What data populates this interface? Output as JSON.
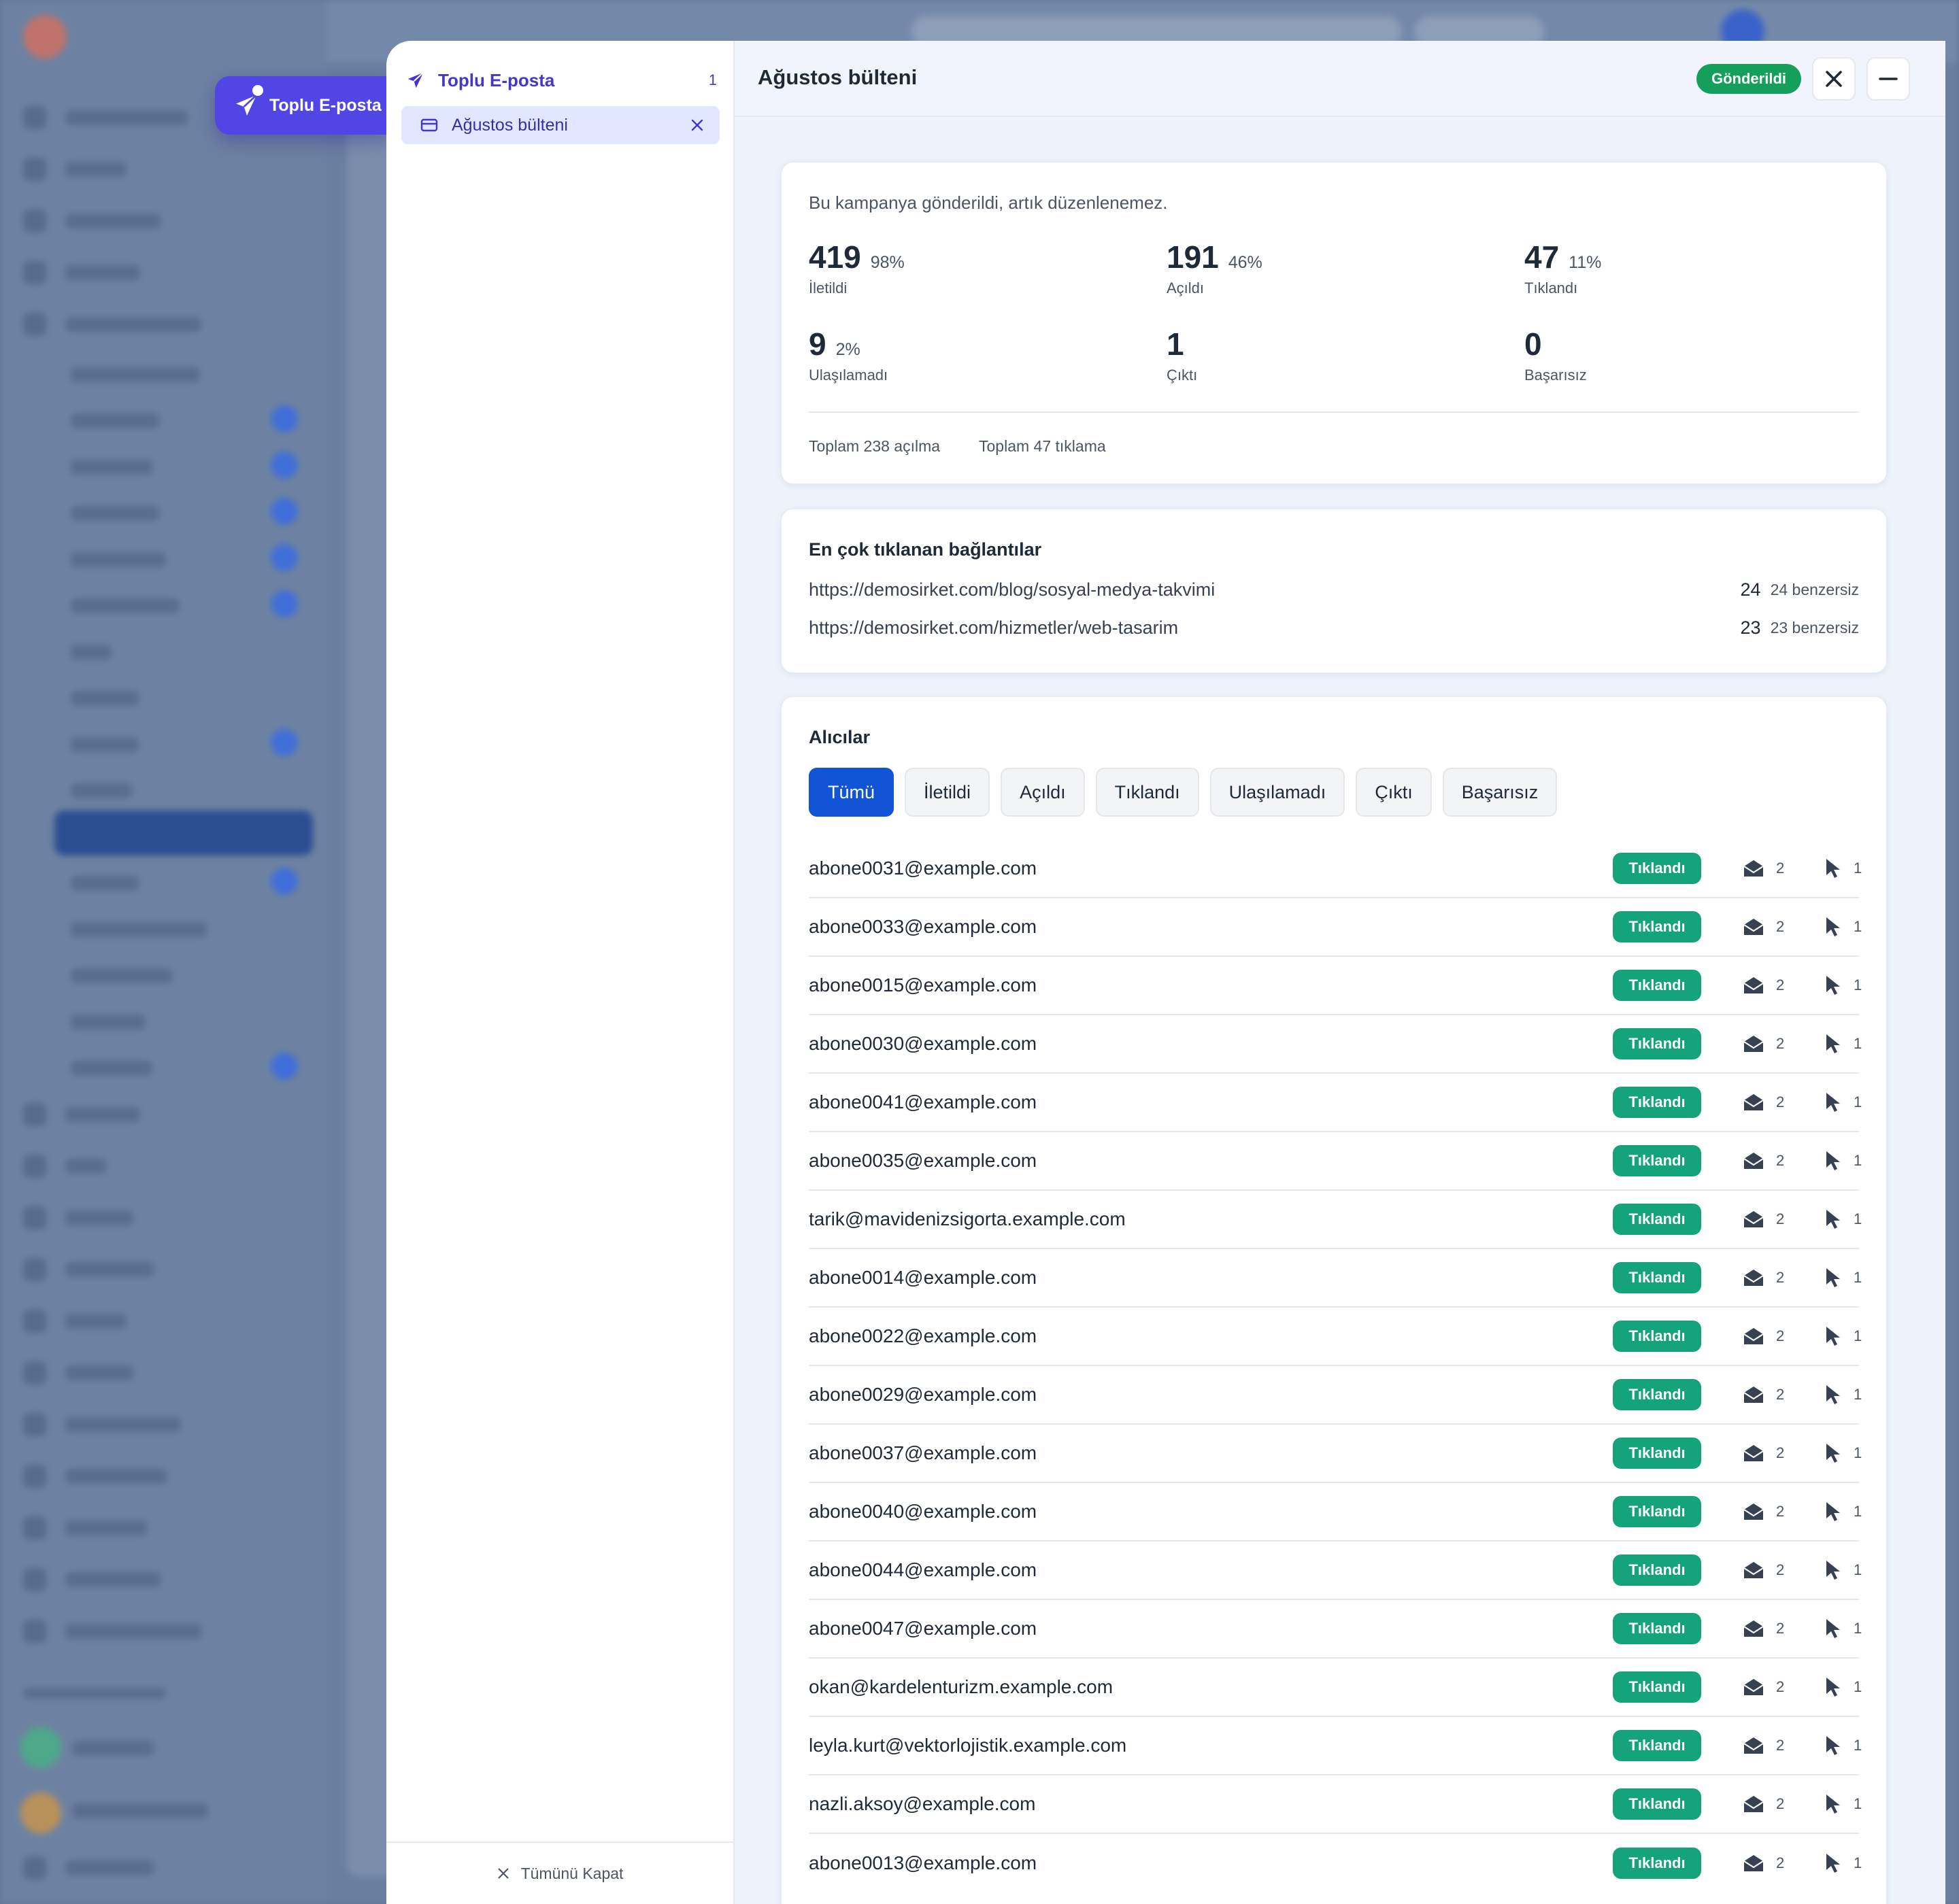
{
  "launcher": {
    "label": "Toplu E-posta"
  },
  "rail": {
    "title": "Toplu E-posta",
    "count": "1",
    "tab_label": "Ağustos bülteni",
    "close_all": "Tümünü Kapat"
  },
  "panel": {
    "title": "Ağustos bülteni",
    "status": "Gönderildi"
  },
  "summary": {
    "notice": "Bu kampanya gönderildi, artık düzenlenemez.",
    "stats": [
      {
        "value": "419",
        "pct": "98%",
        "label": "İletildi"
      },
      {
        "value": "191",
        "pct": "46%",
        "label": "Açıldı"
      },
      {
        "value": "47",
        "pct": "11%",
        "label": "Tıklandı"
      },
      {
        "value": "9",
        "pct": "2%",
        "label": "Ulaşılamadı"
      },
      {
        "value": "1",
        "pct": "",
        "label": "Çıktı"
      },
      {
        "value": "0",
        "pct": "",
        "label": "Başarısız"
      }
    ],
    "total_opens": "Toplam 238 açılma",
    "total_clicks": "Toplam 47 tıklama"
  },
  "links": {
    "title": "En çok tıklanan bağlantılar",
    "items": [
      {
        "url": "https://demosirket.com/blog/sosyal-medya-takvimi",
        "count": "24",
        "unique": "24 benzersiz"
      },
      {
        "url": "https://demosirket.com/hizmetler/web-tasarim",
        "count": "23",
        "unique": "23 benzersiz"
      }
    ]
  },
  "recipients": {
    "title": "Alıcılar",
    "filters": [
      "Tümü",
      "İletildi",
      "Açıldı",
      "Tıklandı",
      "Ulaşılamadı",
      "Çıktı",
      "Başarısız"
    ],
    "active_filter": "Tümü",
    "rows": [
      {
        "email": "abone0031@example.com",
        "status": "Tıklandı",
        "opens": "2",
        "clicks": "1"
      },
      {
        "email": "abone0033@example.com",
        "status": "Tıklandı",
        "opens": "2",
        "clicks": "1"
      },
      {
        "email": "abone0015@example.com",
        "status": "Tıklandı",
        "opens": "2",
        "clicks": "1"
      },
      {
        "email": "abone0030@example.com",
        "status": "Tıklandı",
        "opens": "2",
        "clicks": "1"
      },
      {
        "email": "abone0041@example.com",
        "status": "Tıklandı",
        "opens": "2",
        "clicks": "1"
      },
      {
        "email": "abone0035@example.com",
        "status": "Tıklandı",
        "opens": "2",
        "clicks": "1"
      },
      {
        "email": "tarik@mavidenizsigorta.example.com",
        "status": "Tıklandı",
        "opens": "2",
        "clicks": "1"
      },
      {
        "email": "abone0014@example.com",
        "status": "Tıklandı",
        "opens": "2",
        "clicks": "1"
      },
      {
        "email": "abone0022@example.com",
        "status": "Tıklandı",
        "opens": "2",
        "clicks": "1"
      },
      {
        "email": "abone0029@example.com",
        "status": "Tıklandı",
        "opens": "2",
        "clicks": "1"
      },
      {
        "email": "abone0037@example.com",
        "status": "Tıklandı",
        "opens": "2",
        "clicks": "1"
      },
      {
        "email": "abone0040@example.com",
        "status": "Tıklandı",
        "opens": "2",
        "clicks": "1"
      },
      {
        "email": "abone0044@example.com",
        "status": "Tıklandı",
        "opens": "2",
        "clicks": "1"
      },
      {
        "email": "abone0047@example.com",
        "status": "Tıklandı",
        "opens": "2",
        "clicks": "1"
      },
      {
        "email": "okan@kardelenturizm.example.com",
        "status": "Tıklandı",
        "opens": "2",
        "clicks": "1"
      },
      {
        "email": "leyla.kurt@vektorlojistik.example.com",
        "status": "Tıklandı",
        "opens": "2",
        "clicks": "1"
      },
      {
        "email": "nazli.aksoy@example.com",
        "status": "Tıklandı",
        "opens": "2",
        "clicks": "1"
      },
      {
        "email": "abone0013@example.com",
        "status": "Tıklandı",
        "opens": "2",
        "clicks": "1"
      }
    ]
  },
  "colors": {
    "accent": "#4f46e5",
    "primary_blue": "#1155d6",
    "success": "#14a05a",
    "clicked_badge": "#14a37a"
  },
  "icons": {
    "launcher": "paper-plane-icon",
    "tab": "card-icon",
    "opens": "envelope-open-icon",
    "clicks": "cursor-icon"
  }
}
